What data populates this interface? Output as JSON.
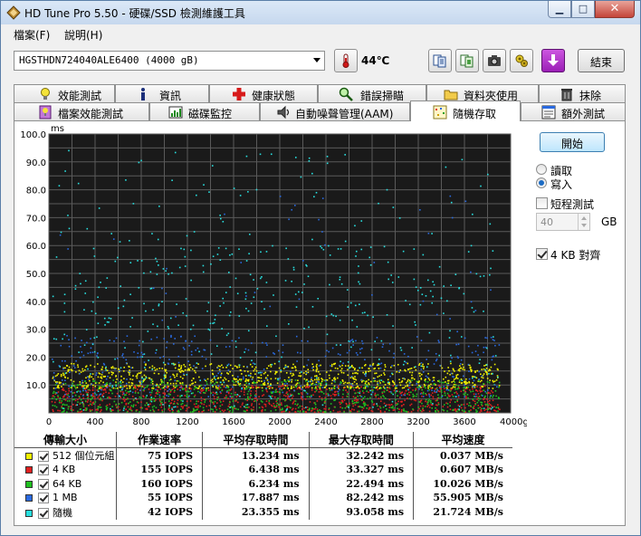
{
  "window": {
    "title": "HD Tune Pro 5.50 - 硬碟/SSD 檢測維護工具",
    "app_icon": "hdtune-logo-icon",
    "controls": [
      "minimize-icon",
      "maximize-icon",
      "close-icon"
    ]
  },
  "menu": [
    {
      "label": "檔案(F)"
    },
    {
      "label": "說明(H)"
    }
  ],
  "toolbar": {
    "drive": "HGSTHDN724040ALE6400 (4000 gB)",
    "temperature": "44℃",
    "exit_label": "結束",
    "icons": [
      "thermometer-icon",
      "copy-text-icon",
      "copy-info-icon",
      "screenshot-icon",
      "options-icon",
      "save-icon"
    ]
  },
  "tabs_row1": [
    {
      "label": "效能測試",
      "icon": "bulb-icon"
    },
    {
      "label": "資訊",
      "icon": "info-icon"
    },
    {
      "label": "健康狀態",
      "icon": "health-cross-icon"
    },
    {
      "label": "錯誤掃瞄",
      "icon": "magnifier-icon"
    },
    {
      "label": "資料夾使用",
      "icon": "folder-icon"
    },
    {
      "label": "抹除",
      "icon": "trash-icon"
    }
  ],
  "tabs_row2": [
    {
      "label": "檔案效能測試",
      "icon": "file-benchmark-icon"
    },
    {
      "label": "磁碟監控",
      "icon": "monitor-chart-icon"
    },
    {
      "label": "自動噪聲管理(AAM)",
      "icon": "speaker-icon"
    },
    {
      "label": "隨機存取",
      "icon": "random-dots-icon",
      "active": true
    },
    {
      "label": "額外測試",
      "icon": "extra-tests-icon"
    }
  ],
  "controls": {
    "start_label": "開始",
    "read_label": "讀取",
    "write_label": "寫入",
    "mode": "write",
    "short_test_label": "短程測試",
    "short_test_checked": false,
    "size_value": "40",
    "size_unit": "GB",
    "align_label": "4 KB 對齊",
    "align_checked": true
  },
  "chart_data": {
    "type": "scatter",
    "title": "",
    "xlabel": "",
    "ylabel": "ms",
    "xlim": [
      0,
      4000
    ],
    "ylim": [
      0,
      100
    ],
    "x_tick_labels": [
      "0",
      "400",
      "800",
      "1200",
      "1600",
      "2000",
      "2400",
      "2800",
      "3200",
      "3600",
      "4000gB"
    ],
    "x_tick_values": [
      0,
      400,
      800,
      1200,
      1600,
      2000,
      2400,
      2800,
      3200,
      3600,
      4000
    ],
    "y_tick_labels": [
      "10.0",
      "20.0",
      "30.0",
      "40.0",
      "50.0",
      "60.0",
      "70.0",
      "80.0",
      "90.0",
      "100.0"
    ],
    "y_tick_values": [
      10,
      20,
      30,
      40,
      50,
      60,
      70,
      80,
      90,
      100
    ],
    "grid": true,
    "background": "#1a1a1a",
    "series": [
      {
        "name": "512 個位元組",
        "color": "#f2f200",
        "typical_ms": [
          9,
          18
        ],
        "points_approx": 900
      },
      {
        "name": "4 KB",
        "color": "#e02020",
        "typical_ms": [
          0.5,
          10
        ],
        "points_approx": 800
      },
      {
        "name": "64 KB",
        "color": "#20c020",
        "typical_ms": [
          0.5,
          12
        ],
        "points_approx": 700
      },
      {
        "name": "1 MB",
        "color": "#2a6ae0",
        "typical_ms": [
          6,
          28
        ],
        "points_approx": 450
      },
      {
        "name": "隨機",
        "color": "#28e0e0",
        "typical_ms": [
          1,
          60
        ],
        "points_approx": 500
      }
    ]
  },
  "results": {
    "headers": [
      "傳輸大小",
      "作業速率",
      "平均存取時間",
      "最大存取時間",
      "平均速度"
    ],
    "rows": [
      {
        "size": "512 個位元組",
        "color": "#f2f200",
        "checked": true,
        "iops": "75 IOPS",
        "avg": "13.234 ms",
        "max": "32.242 ms",
        "speed": "0.037 MB/s"
      },
      {
        "size": "4 KB",
        "color": "#e02020",
        "checked": true,
        "iops": "155 IOPS",
        "avg": "6.438 ms",
        "max": "33.327 ms",
        "speed": "0.607 MB/s"
      },
      {
        "size": "64 KB",
        "color": "#20c020",
        "checked": true,
        "iops": "160 IOPS",
        "avg": "6.234 ms",
        "max": "22.494 ms",
        "speed": "10.026 MB/s"
      },
      {
        "size": "1 MB",
        "color": "#2a6ae0",
        "checked": true,
        "iops": "55 IOPS",
        "avg": "17.887 ms",
        "max": "82.242 ms",
        "speed": "55.905 MB/s"
      },
      {
        "size": "隨機",
        "color": "#28e0e0",
        "checked": true,
        "iops": "42 IOPS",
        "avg": "23.355 ms",
        "max": "93.058 ms",
        "speed": "21.724 MB/s"
      }
    ]
  }
}
